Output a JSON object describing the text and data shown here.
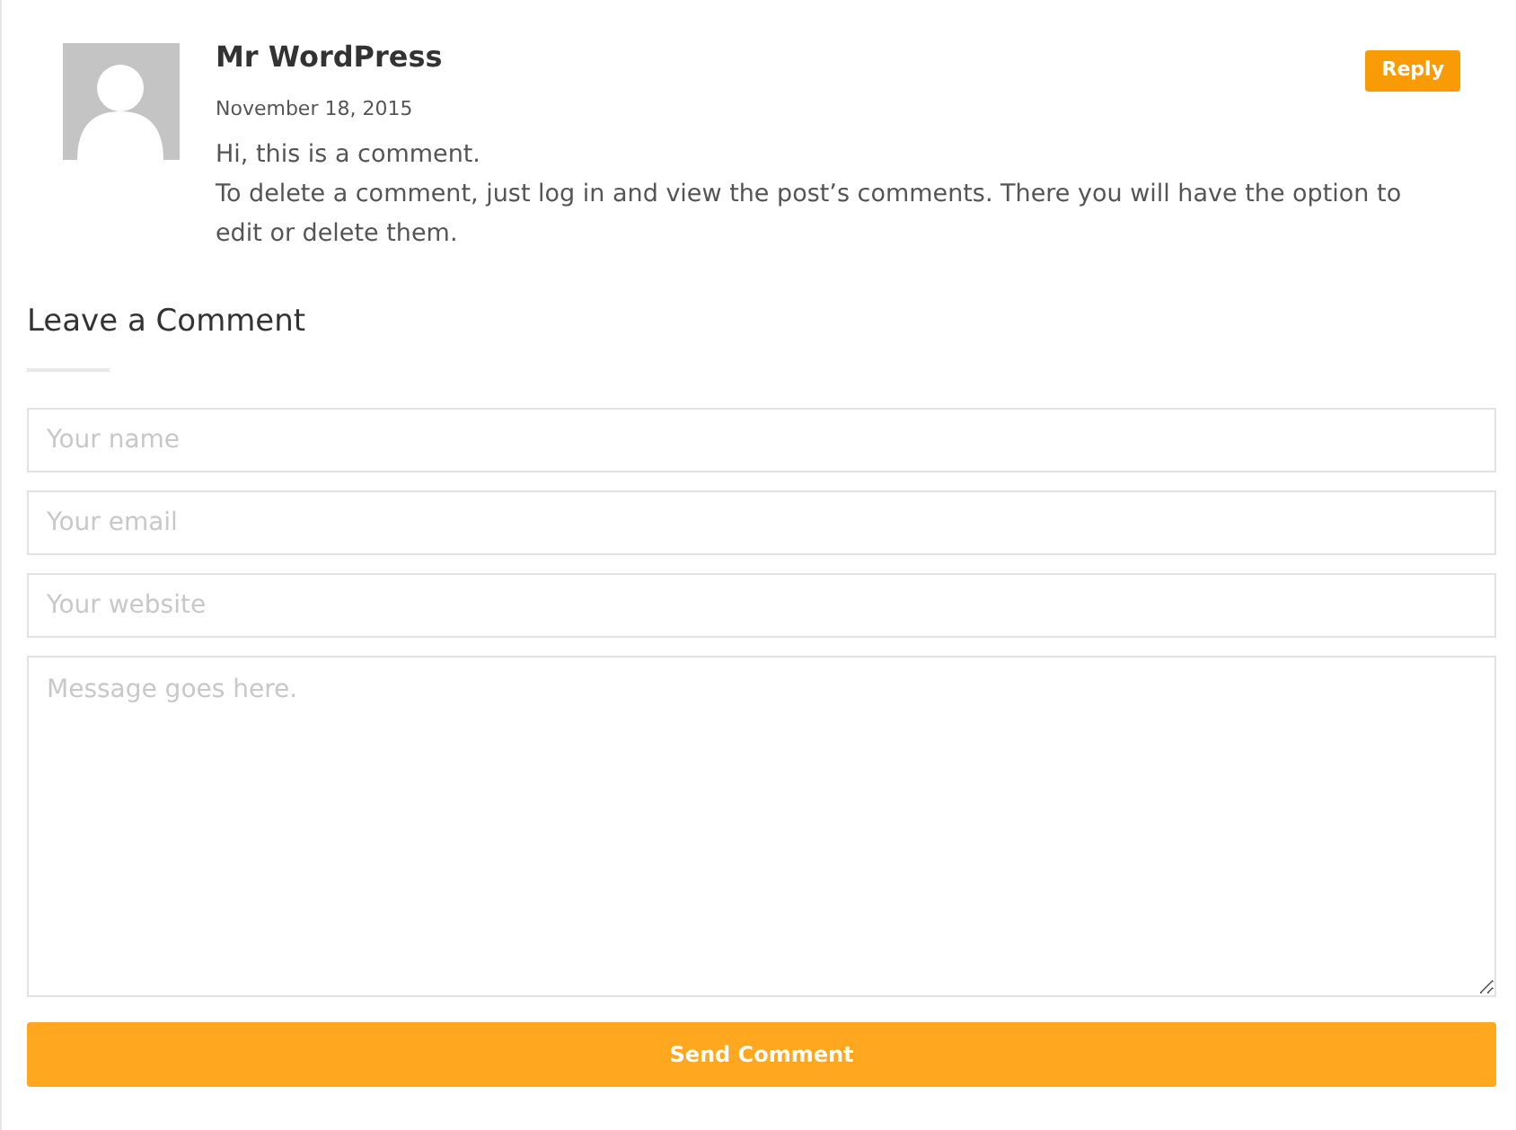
{
  "comment": {
    "author": "Mr WordPress",
    "date": "November 18, 2015",
    "reply_button": "Reply",
    "paragraphs": [
      "Hi, this is a comment.",
      "To delete a comment, just log in and view the post’s comments. There you will have the option to edit or delete them."
    ]
  },
  "form": {
    "title": "Leave a Comment",
    "fields": [
      {
        "kind": "input",
        "placeholder": "Your name"
      },
      {
        "kind": "input",
        "placeholder": "Your email"
      },
      {
        "kind": "input",
        "placeholder": "Your website"
      },
      {
        "kind": "textarea",
        "placeholder": "Message goes here."
      }
    ],
    "submit": "Send Comment"
  }
}
